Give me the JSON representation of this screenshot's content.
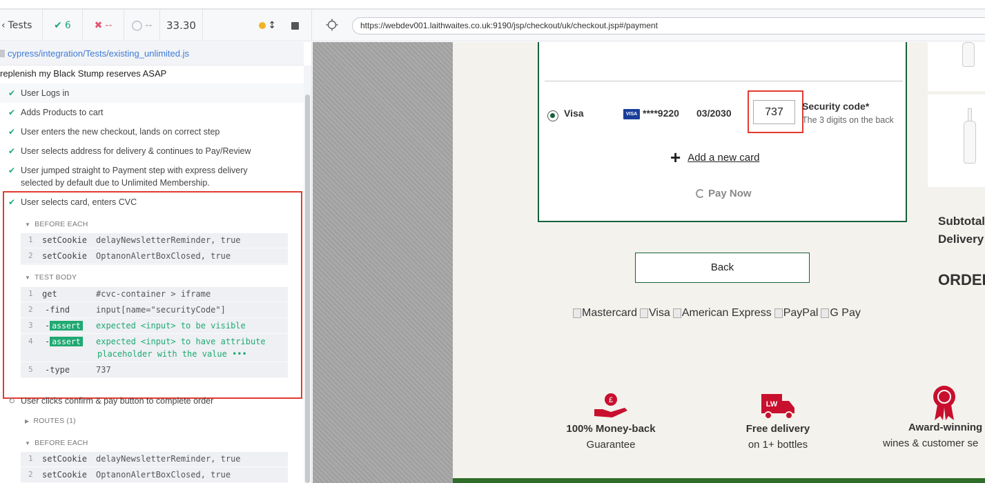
{
  "runner_header": {
    "tests_label": "Tests",
    "passed_count": "6",
    "failed_count": "--",
    "pending_count": "--",
    "duration": "33.30"
  },
  "browser": {
    "url": "https://webdev001.laithwaites.co.uk:9190/jsp/checkout/uk/checkout.jsp#/payment"
  },
  "spec": {
    "file": "cypress/integration/Tests/existing_unlimited.js",
    "suite": "replenish my Black Stump reserves ASAP",
    "tests": [
      {
        "label": "User Logs in",
        "status": "passed"
      },
      {
        "label": "Adds Products to cart",
        "status": "passed"
      },
      {
        "label": "User enters the new checkout, lands on correct step",
        "status": "passed"
      },
      {
        "label": "User selects address for delivery & continues to Pay/Review",
        "status": "passed"
      },
      {
        "label": "User jumped straight to Payment step with express delivery selected by default due to Unlimited Membership.",
        "status": "passed"
      },
      {
        "label": "User selects card, enters CVC",
        "status": "passed"
      },
      {
        "label": "User clicks confirm & pay button to complete order",
        "status": "running"
      }
    ],
    "active_test": {
      "before_each_title": "BEFORE EACH",
      "before_each": [
        {
          "num": "1",
          "name": "setCookie",
          "msg": "delayNewsletterReminder, true"
        },
        {
          "num": "2",
          "name": "setCookie",
          "msg": "OptanonAlertBoxClosed, true"
        }
      ],
      "test_body_title": "TEST BODY",
      "test_body": [
        {
          "num": "1",
          "name": "get",
          "msg": "#cvc-container > iframe"
        },
        {
          "num": "2",
          "name": "-find",
          "msg": "input[name=\"securityCode\"]"
        },
        {
          "num": "3",
          "name": "-",
          "tag": "assert",
          "msg": "expected <input> to be visible"
        },
        {
          "num": "4",
          "name": "-",
          "tag": "assert",
          "msg": "expected <input> to have attribute",
          "msg2": "placeholder with the value •••"
        },
        {
          "num": "5",
          "name": "-type",
          "msg": "737"
        }
      ]
    },
    "next_test": {
      "routes_title": "ROUTES (1)",
      "before_each_title": "BEFORE EACH",
      "before_each": [
        {
          "num": "1",
          "name": "setCookie",
          "msg": "delayNewsletterReminder, true"
        },
        {
          "num": "2",
          "name": "setCookie",
          "msg": "OptanonAlertBoxClosed, true"
        }
      ]
    }
  },
  "checkout": {
    "card": {
      "brand": "Visa",
      "logo_text": "VISA",
      "number": "****9220",
      "expiry": "03/2030",
      "cvc_value": "737",
      "security_label": "Security code*",
      "security_hint": "The 3 digits on the back"
    },
    "add_card_label": "Add a new card",
    "pay_now_label": "Pay Now",
    "back_label": "Back",
    "summary": {
      "subtotal": "Subtotal",
      "delivery": "Delivery",
      "order_title": "ORDER"
    },
    "payment_logos": [
      "Mastercard",
      "Visa",
      "American Express",
      "PayPal",
      "G Pay"
    ],
    "usps": [
      {
        "title": "100% Money-back",
        "sub": "Guarantee",
        "icon": "money-back-hand-icon"
      },
      {
        "title": "Free delivery",
        "sub": "on 1+ bottles",
        "icon": "delivery-truck-icon",
        "badge": "LW"
      },
      {
        "title": "Award-winning",
        "sub": "wines & customer se",
        "icon": "award-rosette-icon"
      }
    ],
    "colors": {
      "accent_green": "#15603b",
      "brand_red": "#c8102e",
      "highlight_red": "#e13a2e",
      "pass_green": "#1fa971"
    }
  }
}
